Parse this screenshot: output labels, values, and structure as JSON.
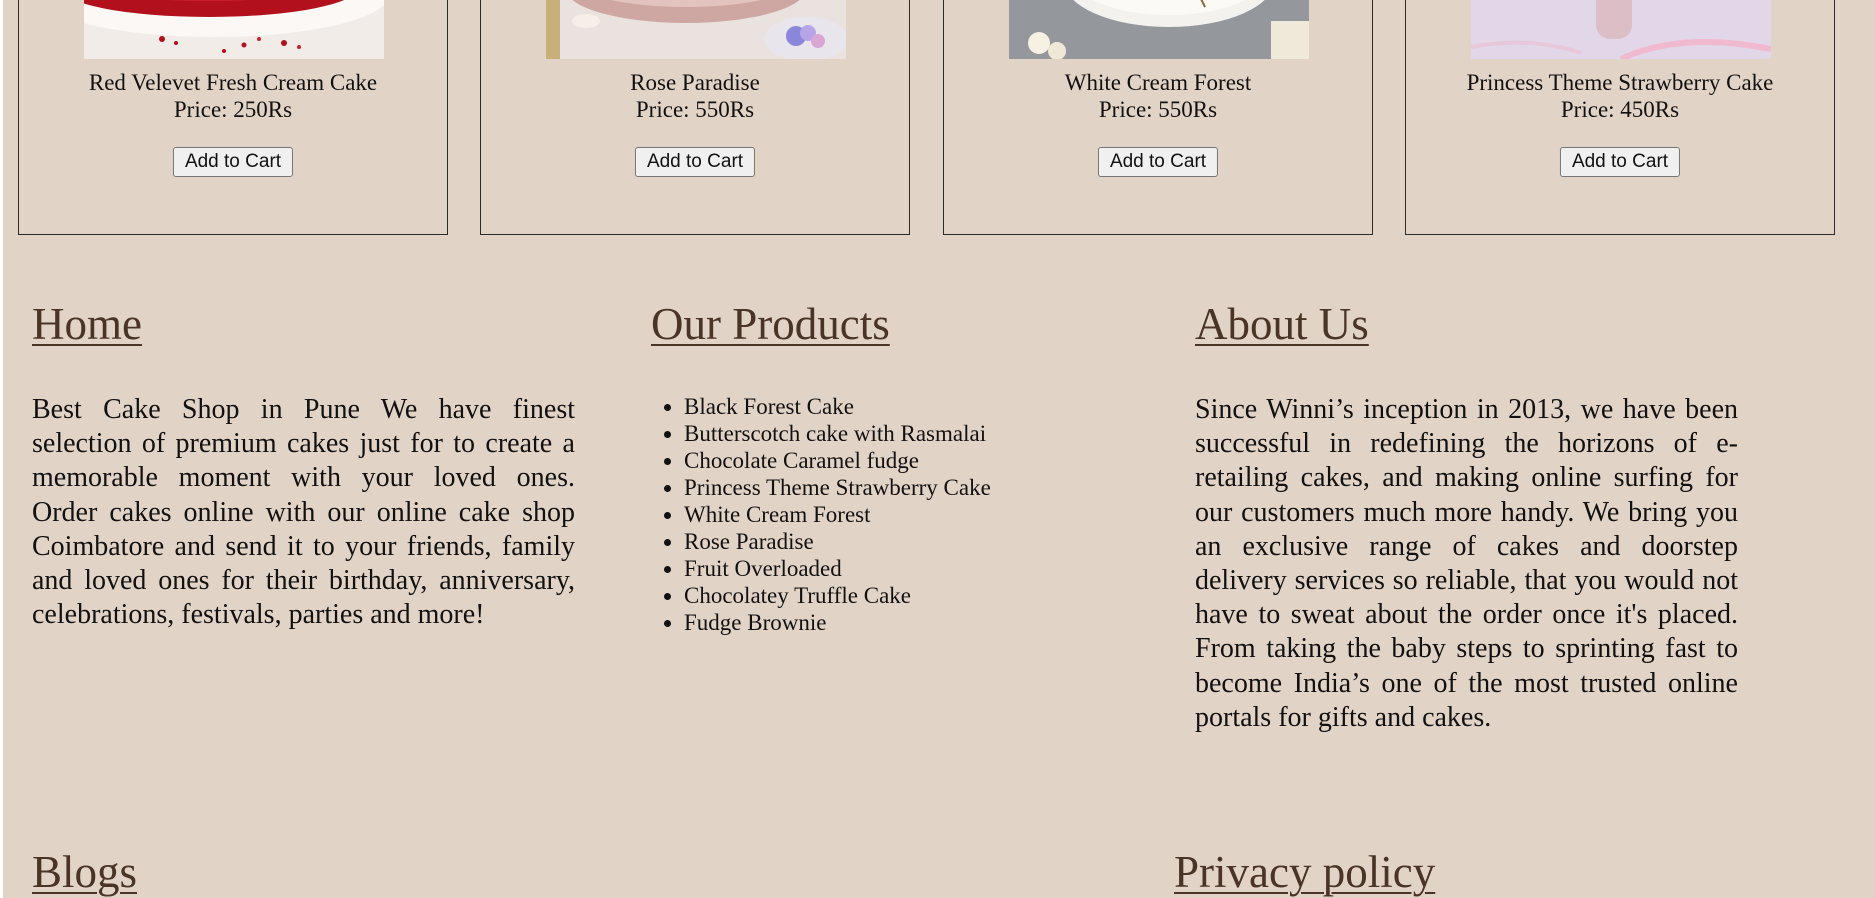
{
  "cards": [
    {
      "name": "Red Velevet Fresh Cream Cake",
      "price": "Price: 250Rs",
      "button": "Add to Cart"
    },
    {
      "name": "Rose Paradise",
      "price": "Price: 550Rs",
      "button": "Add to Cart"
    },
    {
      "name": "White Cream Forest",
      "price": "Price: 550Rs",
      "button": "Add to Cart"
    },
    {
      "name": "Princess Theme Strawberry Cake",
      "price": "Price: 450Rs",
      "button": "Add to Cart"
    }
  ],
  "footer": {
    "home": {
      "title": "Home",
      "text": "Best Cake Shop in Pune We have finest selection of premium cakes just for to create a memorable moment with your loved ones. Order cakes online with our online cake shop Coimbatore and send it to your friends, family and loved ones for their birthday, anniversary, celebrations, festivals, parties and more!"
    },
    "products": {
      "title": "Our Products",
      "items": [
        "Black Forest Cake",
        "Butterscotch cake with Rasmalai",
        "Chocolate Caramel fudge",
        "Princess Theme Strawberry Cake",
        "White Cream Forest",
        "Rose Paradise",
        "Fruit Overloaded",
        "Chocolatey Truffle Cake",
        "Fudge Brownie"
      ]
    },
    "about": {
      "title": "About Us",
      "text": "Since Winni’s inception in 2013, we have been successful in redefining the horizons of e-retailing cakes, and making online surfing for our customers much more handy. We bring you an exclusive range of cakes and doorstep delivery services so reliable, that you would not have to sweat about the order once it's placed. From taking the baby steps to sprinting fast to become India’s one of the most trusted online portals for gifts and cakes."
    },
    "blogs": {
      "title": "Blogs"
    },
    "privacy": {
      "title": "Privacy policy"
    }
  },
  "colors": {
    "page_background": "#e2d3c7",
    "heading": "#4a3426"
  }
}
